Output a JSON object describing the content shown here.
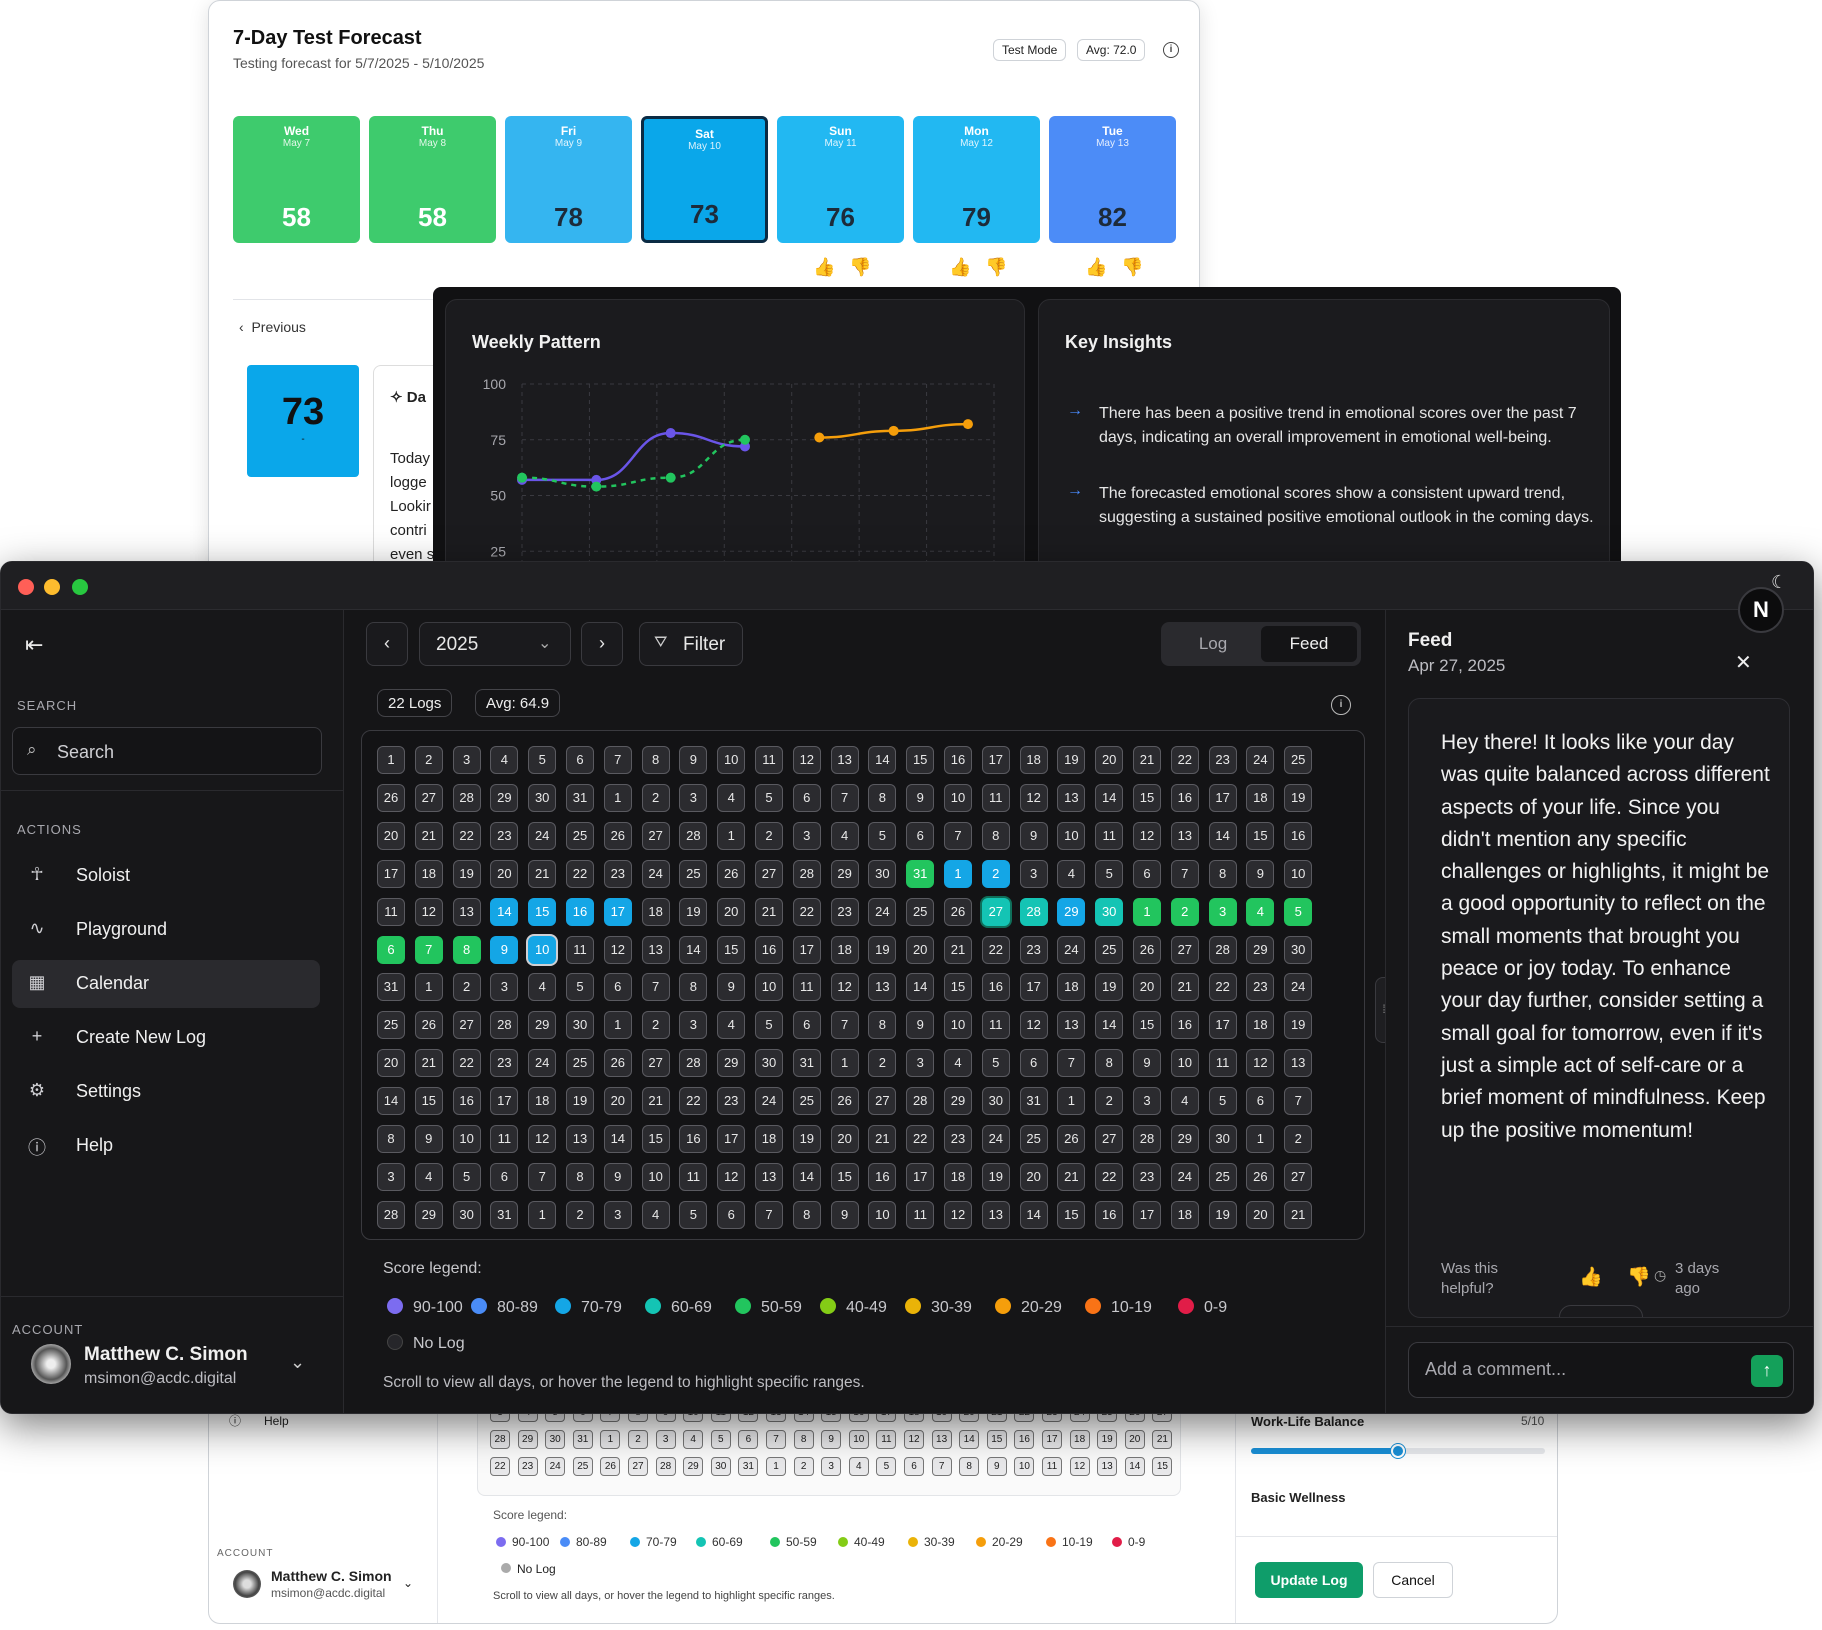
{
  "forecast": {
    "title": "7-Day Test Forecast",
    "subtitle": "Testing forecast for 5/7/2025 - 5/10/2025",
    "mode_pill": "Test Mode",
    "avg_pill": "Avg: 72.0",
    "days": [
      {
        "day": "Wed",
        "date": "May 7",
        "score": "58",
        "color": "#3ecb6d"
      },
      {
        "day": "Thu",
        "date": "May 8",
        "score": "58",
        "color": "#3ecb6d"
      },
      {
        "day": "Fri",
        "date": "May 9",
        "score": "78",
        "color": "#35b5f0"
      },
      {
        "day": "Sat",
        "date": "May 10",
        "score": "73",
        "color": "#0aa7ea"
      },
      {
        "day": "Sun",
        "date": "May 11",
        "score": "76",
        "color": "#22b8f2"
      },
      {
        "day": "Mon",
        "date": "May 12",
        "score": "79",
        "color": "#22b8f2"
      },
      {
        "day": "Tue",
        "date": "May 13",
        "score": "82",
        "color": "#4c8cf7"
      }
    ],
    "previous_label": "Previous",
    "big_score": "73",
    "big_score_sub": "-",
    "detail_snippets": [
      "Da",
      "Today",
      "logge",
      "Lookir",
      "contri",
      "even s"
    ]
  },
  "weekly": {
    "title": "Weekly Pattern",
    "y_ticks": [
      "100",
      "75",
      "50",
      "25"
    ]
  },
  "chart_data": {
    "type": "line",
    "title": "Weekly Pattern",
    "ylim": [
      0,
      100
    ],
    "grid": true,
    "series": [
      {
        "color": "#6a55e8",
        "points": [
          [
            1,
            57
          ],
          [
            2,
            57
          ],
          [
            3,
            78
          ],
          [
            4,
            72
          ]
        ]
      },
      {
        "color": "#22c55e",
        "style": "dashed",
        "points": [
          [
            1,
            58
          ],
          [
            2,
            54
          ],
          [
            3,
            58
          ],
          [
            4,
            75
          ]
        ]
      },
      {
        "color": "#f59e0b",
        "points": [
          [
            5,
            76
          ],
          [
            6,
            79
          ],
          [
            7,
            82
          ]
        ]
      }
    ]
  },
  "insights": {
    "title": "Key Insights",
    "items": [
      "There has been a positive trend in emotional scores over the past 7 days, indicating an overall improvement in emotional well-being.",
      "The forecasted emotional scores show a consistent upward trend, suggesting a sustained positive emotional outlook in the coming days."
    ]
  },
  "sidebar": {
    "search_label": "SEARCH",
    "search_placeholder": "Search",
    "actions_label": "ACTIONS",
    "items": [
      {
        "label": "Soloist",
        "icon": "soloist-icon"
      },
      {
        "label": "Playground",
        "icon": "activity-icon"
      },
      {
        "label": "Calendar",
        "icon": "calendar-icon"
      },
      {
        "label": "Create New Log",
        "icon": "plus-icon"
      },
      {
        "label": "Settings",
        "icon": "gear-icon"
      },
      {
        "label": "Help",
        "icon": "help-icon"
      }
    ],
    "account_label": "ACCOUNT",
    "user_name": "Matthew C. Simon",
    "user_email": "msimon@acdc.digital"
  },
  "calendar": {
    "year": "2025",
    "filter_label": "Filter",
    "seg_log": "Log",
    "seg_feed": "Feed",
    "logs_badge": "22 Logs",
    "avg_badge": "Avg: 64.9",
    "legend_title": "Score legend:",
    "legend": [
      {
        "label": "90-100",
        "color": "#7c6cf0"
      },
      {
        "label": "80-89",
        "color": "#4a8cf7"
      },
      {
        "label": "70-79",
        "color": "#14a6e6"
      },
      {
        "label": "60-69",
        "color": "#14c4b4"
      },
      {
        "label": "50-59",
        "color": "#22c55e"
      },
      {
        "label": "40-49",
        "color": "#84cc16"
      },
      {
        "label": "30-39",
        "color": "#eab308"
      },
      {
        "label": "20-29",
        "color": "#f59e0b"
      },
      {
        "label": "10-19",
        "color": "#f97316"
      },
      {
        "label": "0-9",
        "color": "#e11d48"
      }
    ],
    "no_log": "No Log",
    "hint": "Scroll to view all days, or hover the legend to highlight specific ranges."
  },
  "feed": {
    "title": "Feed",
    "date": "Apr 27, 2025",
    "message": "Hey there! It looks like your day was quite balanced across different aspects of your life. Since you didn't mention any specific challenges or highlights, it might be a good opportunity to reflect on the small moments that brought you peace or joy today. To enhance your day further, consider setting a small goal for tomorrow, even if it's just a simple act of self-care or a brief moment of mindfulness. Keep up the positive momentum!",
    "helpful": "Was this helpful?",
    "ago": "3 days ago",
    "comment_placeholder": "Add a comment...",
    "avatar_letter": "N"
  },
  "bottom": {
    "help": "Help",
    "account_label": "ACCOUNT",
    "user_name": "Matthew C. Simon",
    "user_email": "msimon@acdc.digital",
    "legend_title": "Score legend:",
    "no_log": "No Log",
    "hint": "Scroll to view all days, or hover the legend to highlight specific ranges.",
    "wlb_label": "Work-Life Balance",
    "wlb_value": "5/10",
    "wlb_level": 0.5,
    "basic_label": "Basic Wellness",
    "update_btn": "Update Log",
    "cancel_btn": "Cancel"
  }
}
